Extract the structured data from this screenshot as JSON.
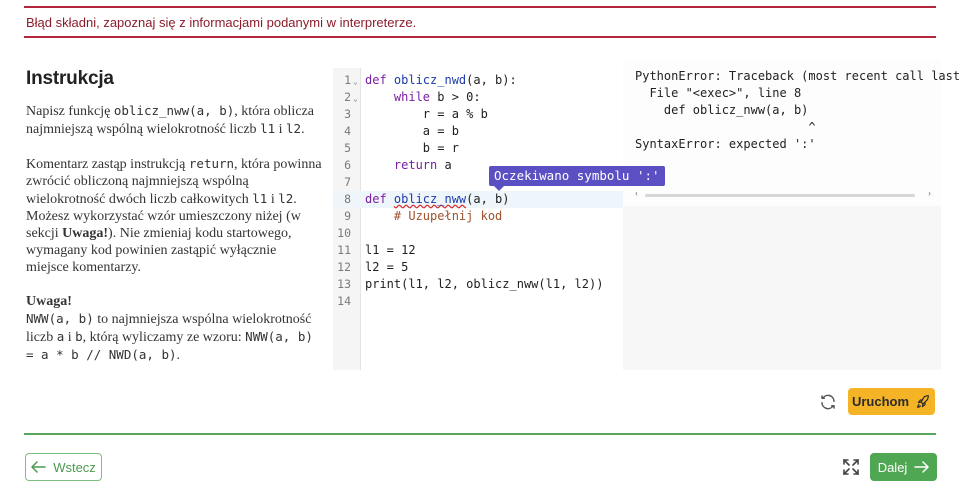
{
  "error_banner": "Błąd składni, zapoznaj się z informacjami podanymi w interpreterze.",
  "instructions": {
    "title": "Instrukcja",
    "p1_a": "Napisz funkcję ",
    "p1_code": "oblicz_nww(a, b)",
    "p1_b": ", która oblicza najmniejszą wspólną wielokrotność liczb ",
    "p1_c1": "l1",
    "p1_i": " i ",
    "p1_c2": "l2",
    "p1_end": ".",
    "p2_a": "Komentarz zastąp instrukcją ",
    "p2_code": "return",
    "p2_b": ", która powinna zwrócić obliczoną najmniejszą wspólną wielokrotność dwóch liczb całkowitych ",
    "p2_c1": "l1",
    "p2_i": " i ",
    "p2_c2": "l2",
    "p2_c": ". Możesz wykorzystać wzór umieszczony niżej (w sekcji ",
    "p2_bold": "Uwaga!",
    "p2_d": "). Nie zmieniaj kodu startowego, wymagany kod powinien zastąpić wyłącznie miejsce komentarzy.",
    "note_title": "Uwaga!",
    "note_code1": "NWW(a, b)",
    "note_a": " to najmniejsza wspólna wielokrotność liczb ",
    "note_c_a": "a",
    "note_i": " i ",
    "note_c_b": "b",
    "note_b": ", którą wyliczamy ze wzoru: ",
    "note_formula": "NWW(a, b) = a * b // NWD(a, b)",
    "note_end": "."
  },
  "editor": {
    "line_numbers": [
      "1",
      "2",
      "3",
      "4",
      "5",
      "6",
      "7",
      "8",
      "9",
      "10",
      "11",
      "12",
      "13",
      "14"
    ],
    "l1_kw": "def ",
    "l1_fn": "oblicz_nwd",
    "l1_rest": "(a, b):",
    "l2_kw": "while",
    "l2_rest": " b > 0:",
    "l3": "r = a % b",
    "l4": "a = b",
    "l5": "b = r",
    "l6_kw": "return",
    "l6_rest": " a",
    "l8_kw": "def ",
    "l8_fn": "oblicz_nww",
    "l8_rest": "(a, b)",
    "l9_comment": "# Uzupełnij kod",
    "l11": "l1 = 12",
    "l12": "l2 = 5",
    "l13": "print(l1, l2, oblicz_nww(l1, l2))"
  },
  "tooltip": "Oczekiwano symbolu ':'",
  "output": {
    "l1": "PythonError: Traceback (most recent call last):",
    "l2": "  File \"<exec>\", line 8",
    "l3": "    def oblicz_nww(a, b)",
    "l4": "                        ^",
    "l5": "SyntaxError: expected ':'"
  },
  "buttons": {
    "run": "Uruchom",
    "back": "Wstecz",
    "next": "Dalej"
  },
  "colors": {
    "error": "#b3263b",
    "run": "#f5b426",
    "next": "#4fa653",
    "tooltip": "#5b4fc4"
  }
}
